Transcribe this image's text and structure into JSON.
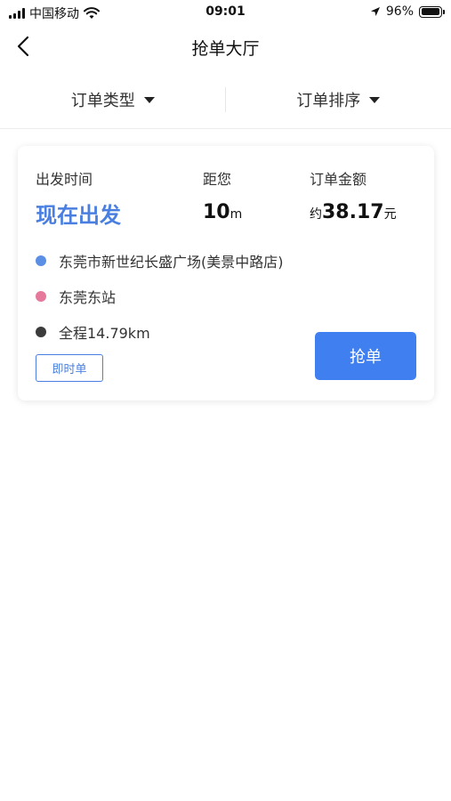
{
  "status_bar": {
    "carrier": "中国移动",
    "time": "09:01",
    "battery_percent": "96%",
    "battery_level": 0.96,
    "icons": [
      "signal-icon",
      "wifi-icon",
      "location-arrow-icon",
      "battery-icon"
    ]
  },
  "nav": {
    "title": "抢单大厅",
    "back_icon": "chevron-left-icon"
  },
  "filters": [
    {
      "label": "订单类型",
      "icon": "caret-down-icon"
    },
    {
      "label": "订单排序",
      "icon": "caret-down-icon"
    }
  ],
  "order": {
    "depart_label": "出发时间",
    "depart_value": "现在出发",
    "distance_label": "距您",
    "distance_value": "10",
    "distance_unit": "m",
    "amount_label": "订单金额",
    "amount_prefix": "约",
    "amount_value": "38.17",
    "amount_unit": "元",
    "start_address": "东莞市新世纪长盛广场(美景中路店)",
    "end_address": "东莞东站",
    "total_distance": "全程14.79km",
    "tag": "即时单",
    "grab_button": "抢单"
  },
  "colors": {
    "accent": "#4a7fe0",
    "button": "#3f7ff0",
    "start_dot": "#5b8fe6",
    "end_dot": "#e6799b",
    "total_dot": "#3b3b3b"
  }
}
